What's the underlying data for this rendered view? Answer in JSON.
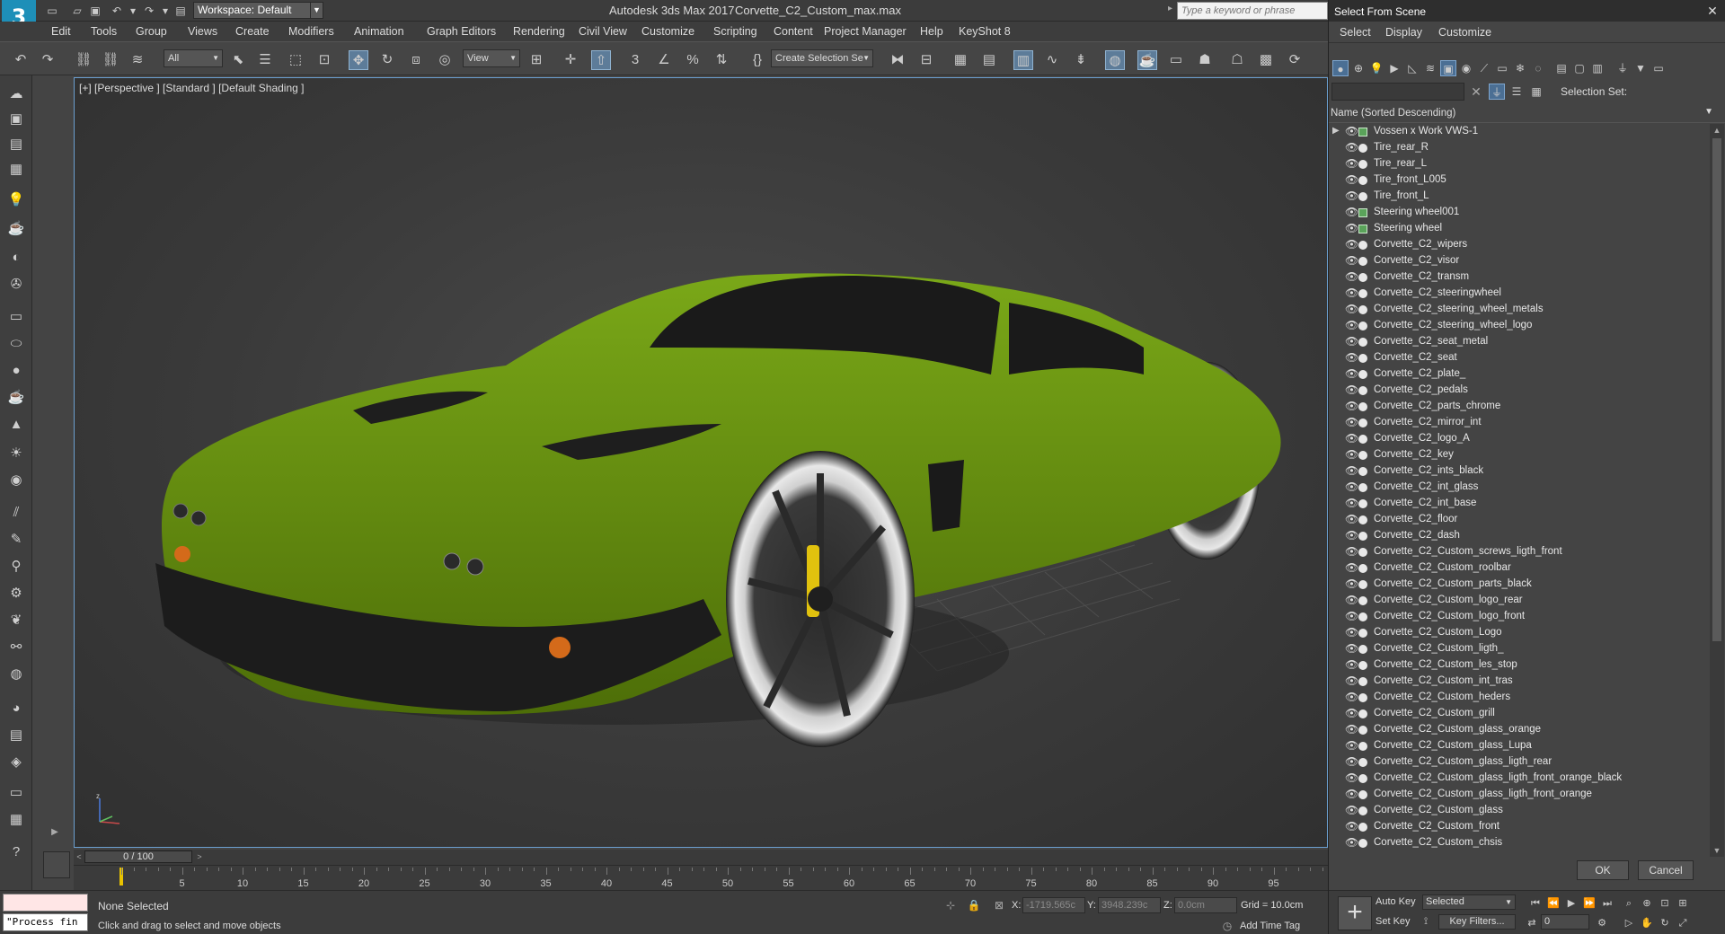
{
  "titlebar": {
    "app_logo": "3",
    "workspace": "Workspace: Default",
    "app_title": "Autodesk 3ds Max 2017",
    "file_title": "Corvette_C2_Custom_max.max",
    "search_placeholder": "Type a keyword or phrase"
  },
  "menu": [
    "Edit",
    "Tools",
    "Group",
    "Views",
    "Create",
    "Modifiers",
    "Animation",
    "Graph Editors",
    "Rendering",
    "Civil View",
    "Customize",
    "Scripting",
    "Content",
    "Project Manager",
    "Help",
    "KeyShot 8"
  ],
  "toolbar": {
    "filter": "All",
    "ref_coord": "View",
    "named_sel": "Create Selection Se"
  },
  "viewport": {
    "label": "[+] [Perspective ] [Standard ] [Default Shading ]",
    "body_color": "#6e9a10"
  },
  "timeline": {
    "position": "0 / 100",
    "ticks": [
      "0",
      "5",
      "10",
      "15",
      "20",
      "25",
      "30",
      "35",
      "40",
      "45",
      "50",
      "55",
      "60",
      "65",
      "70",
      "75",
      "80",
      "85",
      "90",
      "95"
    ]
  },
  "status": {
    "maxscript_output": "\"Process fin",
    "selection": "None Selected",
    "prompt": "Click and drag to select and move objects",
    "x_label": "X:",
    "x_value": "-1719.565c",
    "y_label": "Y:",
    "y_value": "3948.239c",
    "z_label": "Z:",
    "z_value": "0.0cm",
    "grid": "Grid = 10.0cm",
    "time_tag": "Add Time Tag"
  },
  "dialog": {
    "title": "Select From Scene",
    "menu": [
      "Select",
      "Display",
      "Customize"
    ],
    "selection_set_label": "Selection Set:",
    "column_header": "Name (Sorted Descending)",
    "objects": [
      {
        "name": "Vossen x Work VWS-1",
        "group": true,
        "expandable": true
      },
      {
        "name": "Tire_rear_R"
      },
      {
        "name": "Tire_rear_L"
      },
      {
        "name": "Tire_front_L005"
      },
      {
        "name": "Tire_front_L"
      },
      {
        "name": "Steering wheel001",
        "group": true
      },
      {
        "name": "Steering wheel",
        "group": true
      },
      {
        "name": "Corvette_C2_wipers"
      },
      {
        "name": "Corvette_C2_visor"
      },
      {
        "name": "Corvette_C2_transm"
      },
      {
        "name": "Corvette_C2_steeringwheel"
      },
      {
        "name": "Corvette_C2_steering_wheel_metals"
      },
      {
        "name": "Corvette_C2_steering_wheel_logo"
      },
      {
        "name": "Corvette_C2_seat_metal"
      },
      {
        "name": "Corvette_C2_seat"
      },
      {
        "name": "Corvette_C2_plate_"
      },
      {
        "name": "Corvette_C2_pedals"
      },
      {
        "name": "Corvette_C2_parts_chrome"
      },
      {
        "name": "Corvette_C2_mirror_int"
      },
      {
        "name": "Corvette_C2_logo_A"
      },
      {
        "name": "Corvette_C2_key"
      },
      {
        "name": "Corvette_C2_ints_black"
      },
      {
        "name": "Corvette_C2_int_glass"
      },
      {
        "name": "Corvette_C2_int_base"
      },
      {
        "name": "Corvette_C2_floor"
      },
      {
        "name": "Corvette_C2_dash"
      },
      {
        "name": "Corvette_C2_Custom_screws_ligth_front"
      },
      {
        "name": "Corvette_C2_Custom_roolbar"
      },
      {
        "name": "Corvette_C2_Custom_parts_black"
      },
      {
        "name": "Corvette_C2_Custom_logo_rear"
      },
      {
        "name": "Corvette_C2_Custom_logo_front"
      },
      {
        "name": "Corvette_C2_Custom_Logo"
      },
      {
        "name": "Corvette_C2_Custom_ligth_"
      },
      {
        "name": "Corvette_C2_Custom_les_stop"
      },
      {
        "name": "Corvette_C2_Custom_int_tras"
      },
      {
        "name": "Corvette_C2_Custom_heders"
      },
      {
        "name": "Corvette_C2_Custom_grill"
      },
      {
        "name": "Corvette_C2_Custom_glass_orange"
      },
      {
        "name": "Corvette_C2_Custom_glass_Lupa"
      },
      {
        "name": "Corvette_C2_Custom_glass_ligth_rear"
      },
      {
        "name": "Corvette_C2_Custom_glass_ligth_front_orange_black"
      },
      {
        "name": "Corvette_C2_Custom_glass_ligth_front_orange"
      },
      {
        "name": "Corvette_C2_Custom_glass"
      },
      {
        "name": "Corvette_C2_Custom_front"
      },
      {
        "name": "Corvette_C2_Custom_chsis"
      }
    ],
    "ok": "OK",
    "cancel": "Cancel"
  },
  "anim": {
    "auto_key": "Auto Key",
    "set_key": "Set Key",
    "selected": "Selected",
    "key_filters": "Key Filters...",
    "frame": "0"
  }
}
